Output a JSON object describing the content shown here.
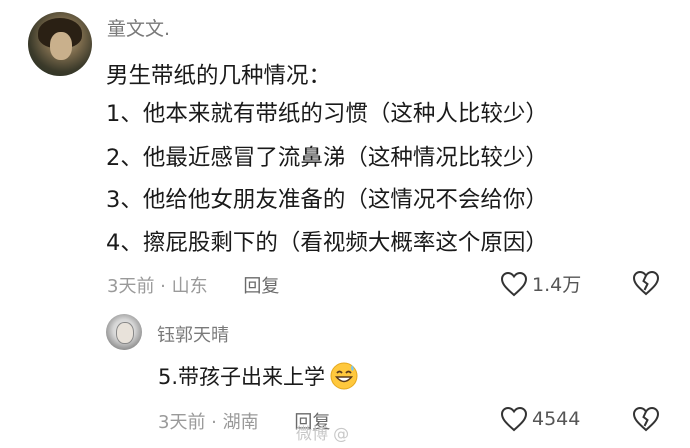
{
  "comment": {
    "username": "童文文.",
    "lines": [
      "男生带纸的几种情况：",
      "1、他本来就有带纸的习惯（这种人比较少）",
      "2、他最近感冒了流鼻涕（这种情况比较少）",
      "3、他给他女朋友准备的（这情况不会给你）",
      "4、擦屁股剩下的（看视频大概率这个原因）"
    ],
    "time_location": "3天前 · 山东",
    "reply_label": "回复",
    "likes": "1.4万"
  },
  "reply": {
    "username": "钰郭天晴",
    "text": "5.带孩子出来上学",
    "emoji": "grinning-sweat-emoji",
    "time_location": "3天前 · 湖南",
    "reply_label": "回复",
    "likes": "4544"
  },
  "watermark": "微博 @"
}
